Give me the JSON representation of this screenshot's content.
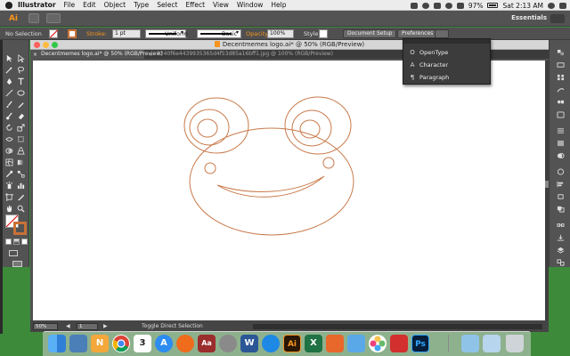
{
  "menubar": {
    "app_name": "Illustrator",
    "items": [
      "File",
      "Edit",
      "Object",
      "Type",
      "Select",
      "Effect",
      "View",
      "Window",
      "Help"
    ],
    "battery": "97%",
    "clock": "Sat 2:13 AM"
  },
  "appbar": {
    "logo": "Ai",
    "workspace": "Essentials"
  },
  "controlbar": {
    "selection_label": "No Selection",
    "stroke_label": "Stroke:",
    "stroke_weight": "1 pt",
    "profile_label": "Uniform",
    "brush_label": "Basic",
    "opacity_label": "Opacity:",
    "opacity_value": "100%",
    "style_label": "Style:",
    "document_setup": "Document Setup",
    "preferences": "Preferences"
  },
  "document": {
    "window_title": "Decentmemes logo.ai* @ 50% (RGB/Preview)",
    "tabs": [
      {
        "label": "Decentmemes logo.ai* @ 50% (RGB/Preview)",
        "active": true
      },
      {
        "label": "2240f6e4439935365d4f53d85a16bff1.jpg @ 100% (RGB/Preview)",
        "active": false
      }
    ],
    "zoom": "50%",
    "page": "1",
    "status_text": "Toggle Direct Selection"
  },
  "float_panel": {
    "items": [
      {
        "icon": "opentype-icon",
        "label": "OpenType"
      },
      {
        "icon": "character-icon",
        "label": "Character"
      },
      {
        "icon": "paragraph-icon",
        "label": "Paragraph"
      }
    ]
  },
  "artwork": {
    "stroke_color": "#c87a4a"
  },
  "dock": {
    "apps": [
      "Finder",
      "Preview",
      "Notes",
      "Chrome",
      "Calendar",
      "App Store",
      "Firefox",
      "Dictionary",
      "System Preferences",
      "Word",
      "Safari",
      "Illustrator",
      "Excel",
      "Vectorize",
      "Photo Viewer",
      "Photos",
      "Acrobat",
      "Photoshop",
      "Downloads",
      "Documents",
      "Trash"
    ],
    "calendar_day": "3"
  },
  "colors": {
    "menubar_bg": "#ececec",
    "panel_bg": "#535353",
    "accent_orange": "#f7941e"
  }
}
